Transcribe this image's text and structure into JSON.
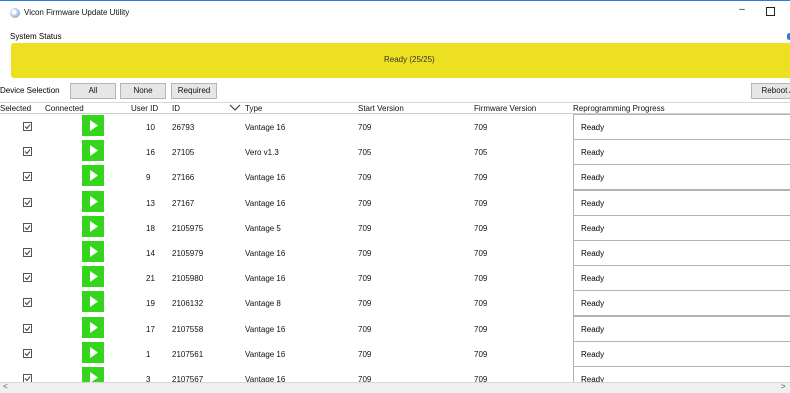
{
  "window": {
    "title": "Vicon Firmware Update Utility",
    "minimize_glyph": "–"
  },
  "system_status": {
    "label": "System Status",
    "status_text": "Ready (25/25)",
    "status_color": "#ede021"
  },
  "device_selection": {
    "label": "Device Selection",
    "all": "All",
    "none": "None",
    "required": "Required",
    "reboot": "Reboot A"
  },
  "table": {
    "columns": [
      "Selected",
      "Connected",
      "User ID",
      "ID",
      "Type",
      "Start Version",
      "Firmware Version",
      "Reprogramming Progress"
    ],
    "rows": [
      {
        "user_id": "10",
        "id": "26793",
        "type": "Vantage 16",
        "start": "709",
        "firmware": "709",
        "progress": "Ready"
      },
      {
        "user_id": "16",
        "id": "27105",
        "type": "Vero v1.3",
        "start": "705",
        "firmware": "705",
        "progress": "Ready"
      },
      {
        "user_id": "9",
        "id": "27166",
        "type": "Vantage 16",
        "start": "709",
        "firmware": "709",
        "progress": "Ready"
      },
      {
        "user_id": "13",
        "id": "27167",
        "type": "Vantage 16",
        "start": "709",
        "firmware": "709",
        "progress": "Ready"
      },
      {
        "user_id": "18",
        "id": "2105975",
        "type": "Vantage 5",
        "start": "709",
        "firmware": "709",
        "progress": "Ready"
      },
      {
        "user_id": "14",
        "id": "2105979",
        "type": "Vantage 16",
        "start": "709",
        "firmware": "709",
        "progress": "Ready"
      },
      {
        "user_id": "21",
        "id": "2105980",
        "type": "Vantage 16",
        "start": "709",
        "firmware": "709",
        "progress": "Ready"
      },
      {
        "user_id": "19",
        "id": "2106132",
        "type": "Vantage 8",
        "start": "709",
        "firmware": "709",
        "progress": "Ready"
      },
      {
        "user_id": "17",
        "id": "2107558",
        "type": "Vantage 16",
        "start": "709",
        "firmware": "709",
        "progress": "Ready"
      },
      {
        "user_id": "1",
        "id": "2107561",
        "type": "Vantage 16",
        "start": "709",
        "firmware": "709",
        "progress": "Ready"
      },
      {
        "user_id": "3",
        "id": "2107567",
        "type": "Vantage 16",
        "start": "709",
        "firmware": "709",
        "progress": "Ready"
      }
    ]
  },
  "scrollbar": {
    "left_arrow": "<",
    "right_arrow": ">"
  },
  "colors": {
    "connected_green": "#34d51c",
    "accent_blue": "#2f7fd1"
  }
}
